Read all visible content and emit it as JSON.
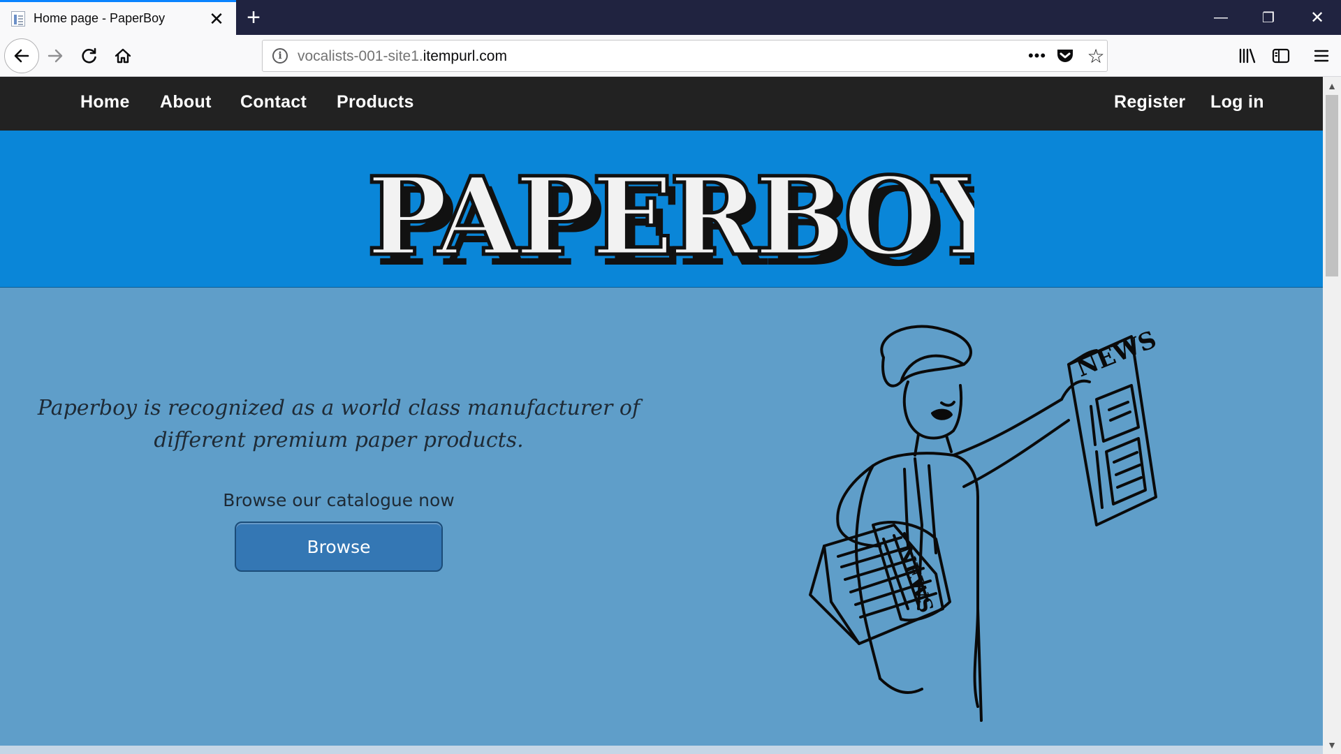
{
  "browser": {
    "tab_title": "Home page - PaperBoy",
    "tab_close": "✕",
    "new_tab": "+",
    "url_domain_prefix": "vocalists-001-site1.",
    "url_domain_main": "itempurl.com",
    "page_actions": "•••",
    "window_controls": {
      "minimize": "—",
      "restore": "❐",
      "close": "✕"
    },
    "icons": [
      "page-favicon-icon",
      "back-arrow-icon",
      "forward-arrow-icon",
      "reload-icon",
      "home-icon",
      "info-icon",
      "more-icon",
      "pocket-icon",
      "star-icon",
      "library-icon",
      "sidebar-icon",
      "hamburger-menu-icon"
    ]
  },
  "site": {
    "nav": {
      "left": [
        "Home",
        "About",
        "Contact",
        "Products"
      ],
      "right": [
        "Register",
        "Log in"
      ]
    },
    "logo_text": "PAPERBOY",
    "hero": {
      "tagline": "Paperboy is recognized as a world class manufacturer of different premium paper products.",
      "browse_caption": "Browse our catalogue now",
      "browse_button": "Browse",
      "newspaper_label": "NEWS"
    },
    "colors": {
      "nav_bg": "#222222",
      "banner_bg": "#0a86d8",
      "hero_bg": "#5f9ec9",
      "button_bg": "#3477b4"
    }
  }
}
